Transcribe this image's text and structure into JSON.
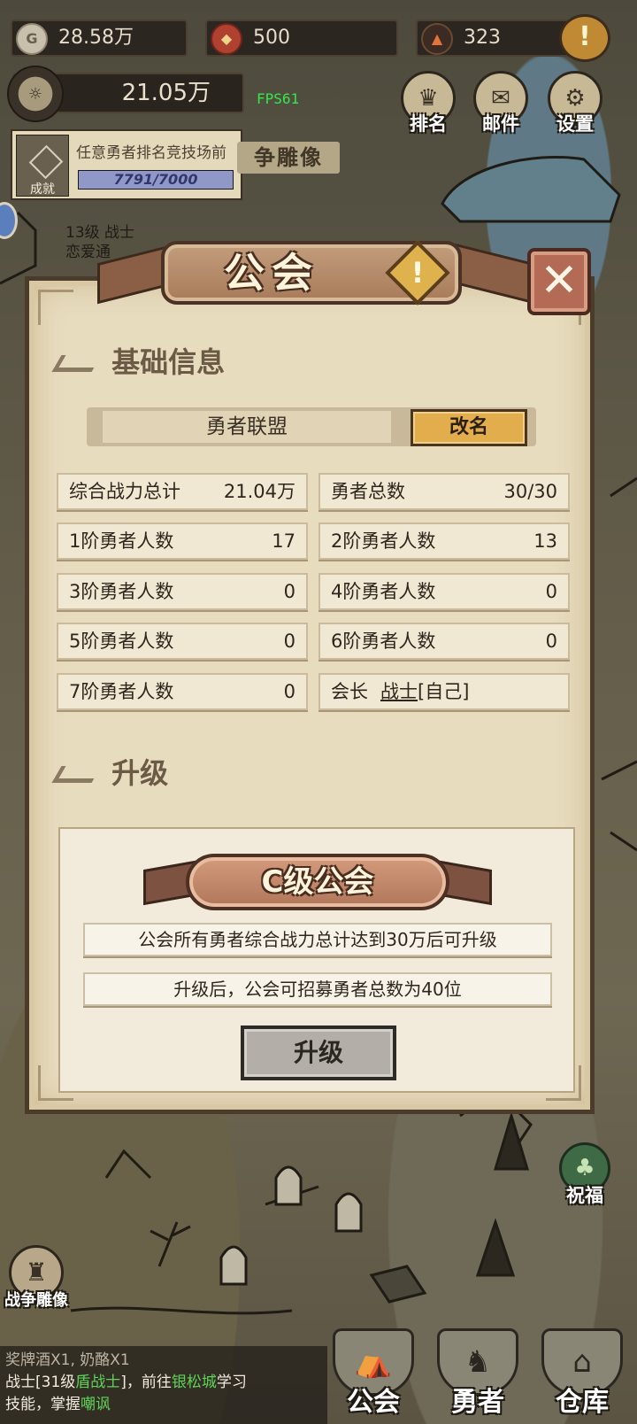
{
  "resources": {
    "gold": "28.58万",
    "gems": "500",
    "crystals": "323"
  },
  "alert_icon": "!",
  "power": "21.05万",
  "fps": "FPS61",
  "quest": {
    "icon_label": "成就",
    "title": "任意勇者排名竞技场前",
    "progress_current": "7791",
    "progress_target": "7000",
    "progress_text": "7791/7000"
  },
  "top_buttons": {
    "rank": "排名",
    "mail": "邮件",
    "settings": "设置"
  },
  "background": {
    "statue_banner": "争雕像",
    "npc_line1": "13级 战士",
    "npc_line2": "恋爱通"
  },
  "modal": {
    "title": "公会",
    "close": "✕",
    "help": "!",
    "basic_section": "基础信息",
    "guild_name": "勇者联盟",
    "rename_button": "改名",
    "stats": [
      {
        "label": "综合战力总计",
        "value": "21.04万"
      },
      {
        "label": "勇者总数",
        "value": "30/30"
      },
      {
        "label": "1阶勇者人数",
        "value": "17"
      },
      {
        "label": "2阶勇者人数",
        "value": "13"
      },
      {
        "label": "3阶勇者人数",
        "value": "0"
      },
      {
        "label": "4阶勇者人数",
        "value": "0"
      },
      {
        "label": "5阶勇者人数",
        "value": "0"
      },
      {
        "label": "6阶勇者人数",
        "value": "0"
      },
      {
        "label": "7阶勇者人数",
        "value": "0"
      }
    ],
    "leader_label": "会长",
    "leader_name": "战士",
    "leader_self": "[自己]",
    "upgrade_section": "升级",
    "grade": "C级公会",
    "requirement": "公会所有勇者综合战力总计达到30万后可升级",
    "benefit": "升级后，公会可招募勇者总数为40位",
    "upgrade_button": "升级"
  },
  "side_buttons": {
    "blessing": "祝福",
    "war_statue": "战争雕像"
  },
  "log": {
    "line0": "奖牌酒X1, 奶酪X1",
    "line1_a": "战士[31级",
    "line1_b": "盾战士",
    "line1_c": "]，前往",
    "line1_d": "银松城",
    "line1_e": "学习",
    "line2_a": "技能，掌握",
    "line2_b": "嘲讽"
  },
  "nav": {
    "guild": "公会",
    "heroes": "勇者",
    "warehouse": "仓库"
  },
  "icons": {
    "gold": "coin-icon",
    "gems": "shield-gem-icon",
    "crystals": "crystal-icon",
    "rank": "crown-icon",
    "mail": "envelope-icon",
    "settings": "gear-icon",
    "close": "close-icon",
    "help": "exclamation-icon"
  },
  "colors": {
    "panel": "#e8dcbf",
    "rename_button": "#e1ad4d",
    "upgrade_button_disabled": "#b3afa8",
    "fps": "#33e84a",
    "log_highlight": "#5fd35a"
  }
}
